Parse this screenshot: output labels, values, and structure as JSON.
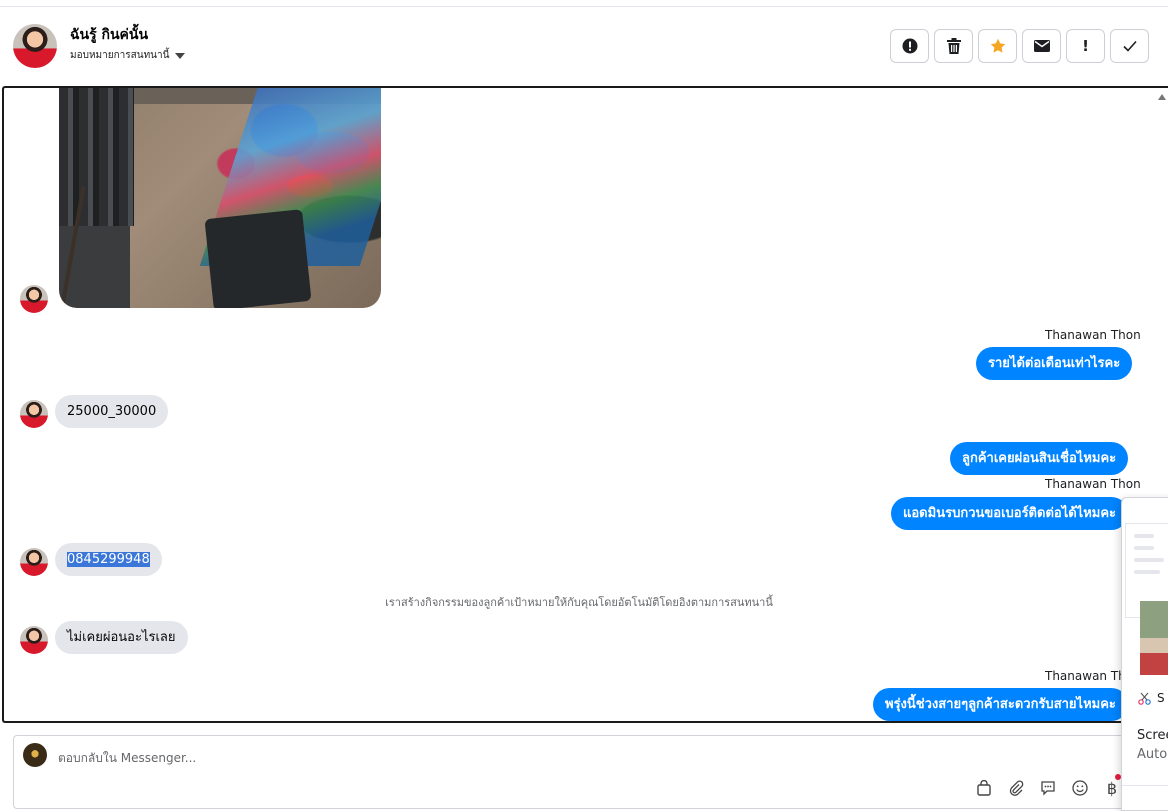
{
  "header": {
    "contact_name": "ฉันรู้ กินค่นั้น",
    "assign_label": "มอบหมายการสนทนานี้"
  },
  "toolbar": {
    "icons": [
      "alert-circle-icon",
      "trash-icon",
      "star-icon",
      "envelope-icon",
      "exclamation-icon",
      "checkmark-icon"
    ],
    "star_color": "#f5a623",
    "exclamation_label": "!"
  },
  "messages": {
    "m1_sender": "Thanawan Thon",
    "m1_text": "รายได้ต่อเดือนเท่าไรคะ",
    "m2_text": "25000_30000",
    "m3_text": "ลูกค้าเคยผ่อนสินเชื่อไหมคะ",
    "m4_sender": "Thanawan Thon",
    "m4_text": "แอดมินรบกวนขอเบอร์ติดต่อได้ไหมคะ",
    "m5_text": "0845299948",
    "system_note": "เราสร้างกิจกรรมของลูกค้าเป้าหมายให้กับคุณโดยอัตโนมัติโดยอิงตามการสนทนานี้",
    "m6_text": "ไม่เคยผ่อนอะไรเลย",
    "m7_sender": "Thanawan Thon",
    "m7_text": "พรุ่งนี้ช่วงสายๆลูกค้าสะดวกรับสายไหมคะ"
  },
  "popup": {
    "snip_label": "S",
    "line1": "Scree",
    "line2": "Auto"
  },
  "composer": {
    "placeholder": "ตอบกลับใน Messenger...",
    "currency_label": "฿"
  },
  "colors": {
    "outgoing_bubble": "#0084ff",
    "incoming_bubble": "#e4e6eb",
    "selection": "#3a77d8"
  }
}
